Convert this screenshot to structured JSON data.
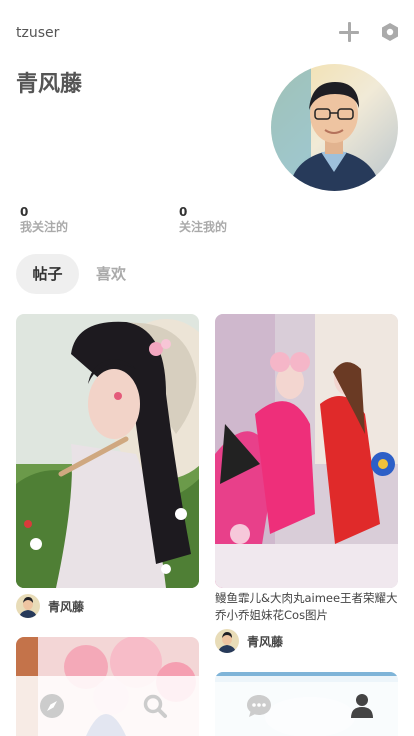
{
  "header": {
    "username": "tzuser",
    "add_icon": "plus-icon",
    "settings_icon": "hexagon-gear-icon"
  },
  "profile": {
    "display_name": "青风藤",
    "avatar": "avatar-photo-man-glasses"
  },
  "stats": {
    "following": {
      "count": "0",
      "label": "我关注的"
    },
    "followers": {
      "count": "0",
      "label": "关注我的"
    }
  },
  "tabs": [
    {
      "label": "帖子",
      "active": true
    },
    {
      "label": "喜欢",
      "active": false
    }
  ],
  "posts": [
    {
      "image": "photo-girl-hanfu-flowers",
      "title": "",
      "author": "青风藤"
    },
    {
      "image": "photo-cosplay-pair-pink-red",
      "title": "鳗鱼霏儿&大肉丸aimee王者荣耀大乔小乔姐妹花Cos图片",
      "author": "青风藤"
    },
    {
      "image": "photo-pink-blossoms",
      "title": "",
      "author": ""
    },
    {
      "image": "photo-light-blue",
      "title": "",
      "author": ""
    }
  ],
  "nav": [
    {
      "icon": "compass-icon",
      "active": false
    },
    {
      "icon": "search-icon",
      "active": false
    },
    {
      "icon": "chat-bubble-icon",
      "active": false
    },
    {
      "icon": "user-icon",
      "active": true
    }
  ],
  "colors": {
    "icon_inactive": "#cccccc",
    "icon_active": "#444444",
    "tab_active_bg": "#efefef"
  }
}
